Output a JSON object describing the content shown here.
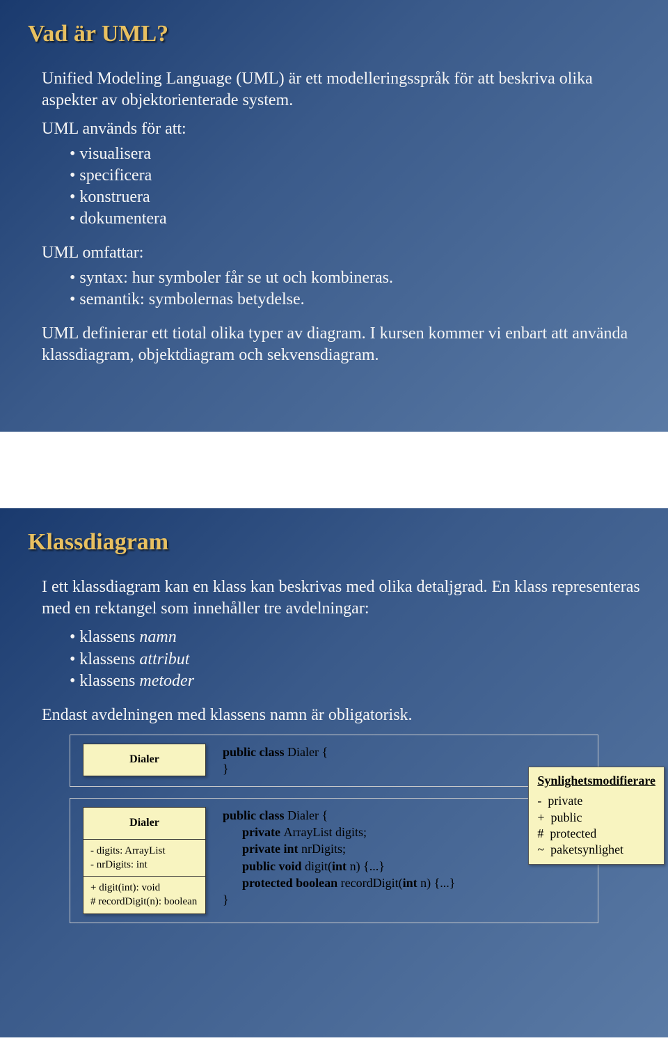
{
  "slide1": {
    "title": "Vad är UML?",
    "intro": "Unified Modeling Language (UML) är ett modelleringsspråk för att beskriva olika aspekter av objektorienterade system.",
    "usedFor": "UML används för att:",
    "usedForItems": [
      "visualisera",
      "specificera",
      "konstruera",
      "dokumentera"
    ],
    "covers": "UML omfattar:",
    "coversItems": [
      "syntax: hur symboler får se ut och kombineras.",
      "semantik: symbolernas betydelse."
    ],
    "diagrams": "UML definierar ett tiotal olika typer av diagram. I kursen kommer vi enbart att använda klassdiagram, objektdiagram och sekvensdiagram."
  },
  "slide2": {
    "title": "Klassdiagram",
    "intro": "I ett klassdiagram kan en klass kan beskrivas med olika detaljgrad. En klass representeras med en rektangel som innehåller tre avdelningar:",
    "parts": [
      {
        "pre": "klassens ",
        "it": "namn"
      },
      {
        "pre": "klassens ",
        "it": "attribut"
      },
      {
        "pre": "klassens ",
        "it": "metoder"
      }
    ],
    "note": "Endast avdelningen med klassens namn är obligatorisk.",
    "example1": {
      "className": "Dialer",
      "code": {
        "l1a": "public class ",
        "l1b": "Dialer {",
        "l2": "}"
      }
    },
    "example2": {
      "className": "Dialer",
      "attrs": [
        "- digits: ArrayList",
        "- nrDigits: int"
      ],
      "methods": [
        "+ digit(int): void",
        "# recordDigit(n): boolean"
      ],
      "code": {
        "l1a": "public class ",
        "l1b": "Dialer {",
        "l2a": "private ",
        "l2b": "ArrayList digits;",
        "l3a": "private int ",
        "l3b": "nrDigits;",
        "l4a": "public void ",
        "l4b": "digit(",
        "l4c": "int ",
        "l4d": "n) {...}",
        "l5a": "protected boolean ",
        "l5b": "recordDigit(",
        "l5c": "int ",
        "l5d": "n) {...}",
        "l6": "}"
      }
    },
    "visibility": {
      "title": "Synlighetsmodifierare",
      "rows": [
        "-  private",
        "+  public",
        "#  protected",
        "~  paketsynlighet"
      ]
    }
  }
}
